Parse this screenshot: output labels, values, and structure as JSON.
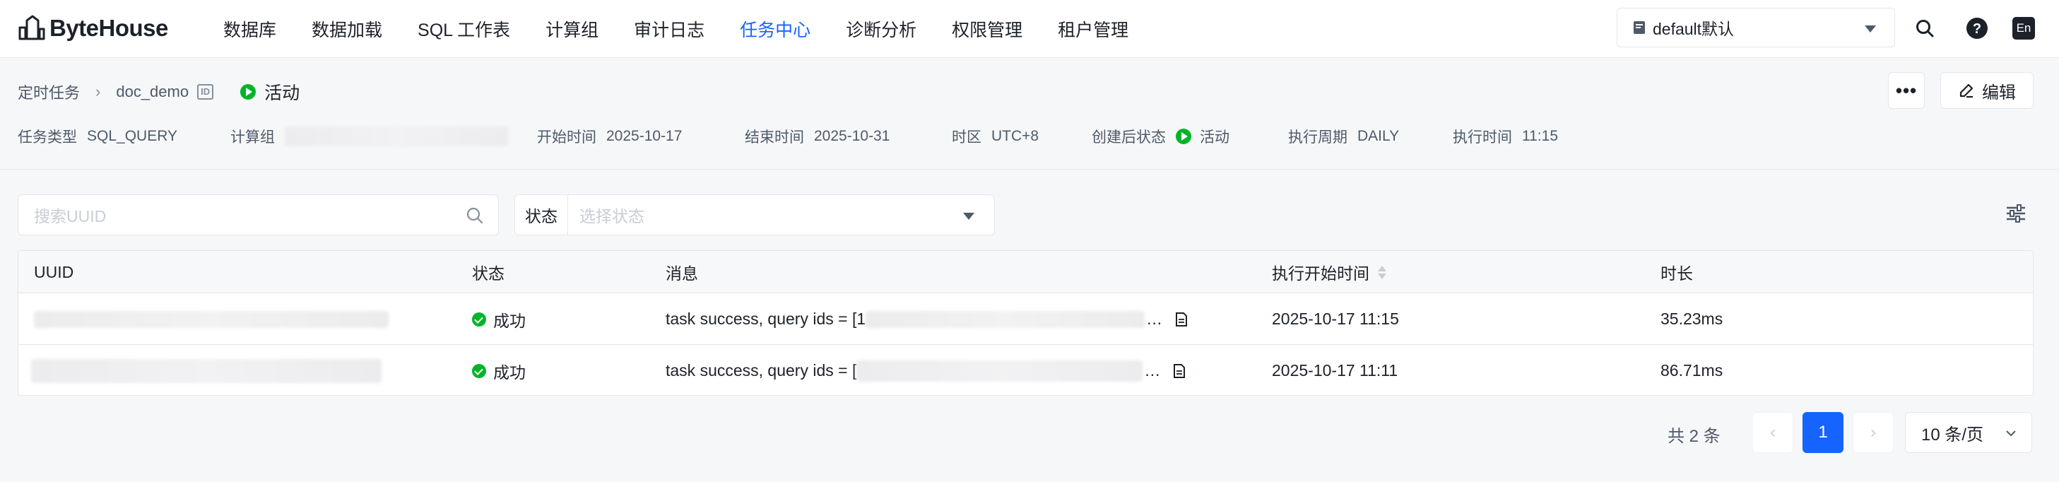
{
  "app": {
    "logo_text": "ByteHouse"
  },
  "menu": [
    {
      "label": "数据库",
      "active": false
    },
    {
      "label": "数据加载",
      "active": false
    },
    {
      "label": "SQL 工作表",
      "active": false
    },
    {
      "label": "计算组",
      "active": false
    },
    {
      "label": "审计日志",
      "active": false
    },
    {
      "label": "任务中心",
      "active": true
    },
    {
      "label": "诊断分析",
      "active": false
    },
    {
      "label": "权限管理",
      "active": false
    },
    {
      "label": "租户管理",
      "active": false
    }
  ],
  "db_select": {
    "value": "default默认"
  },
  "lang_toggle": "En",
  "breadcrumb": {
    "root": "定时任务",
    "current": "doc_demo",
    "id_badge": "ID",
    "status": "活动"
  },
  "actions": {
    "more": "•••",
    "edit": "编辑"
  },
  "meta": {
    "task_type_label": "任务类型",
    "task_type": "SQL_QUERY",
    "compute_group_label": "计算组",
    "start_label": "开始时间",
    "start": "2025-10-17",
    "end_label": "结束时间",
    "end": "2025-10-31",
    "tz_label": "时区",
    "tz": "UTC+8",
    "post_status_label": "创建后状态",
    "post_status": "活动",
    "period_label": "执行周期",
    "period": "DAILY",
    "exec_time_label": "执行时间",
    "exec_time": "11:15"
  },
  "filters": {
    "search_placeholder": "搜索UUID",
    "status_label": "状态",
    "status_placeholder": "选择状态"
  },
  "table": {
    "columns": [
      "UUID",
      "状态",
      "消息",
      "执行开始时间",
      "时长"
    ],
    "rows": [
      {
        "status": "成功",
        "message": "task success, query ids = [1",
        "start": "2025-10-17 11:15",
        "duration": "35.23ms"
      },
      {
        "status": "成功",
        "message": "task success, query ids = [",
        "start": "2025-10-17 11:11",
        "duration": "86.71ms"
      }
    ]
  },
  "pagination": {
    "total": "共 2 条",
    "current_page": "1",
    "page_size": "10 条/页",
    "prev": "‹",
    "next": "›"
  }
}
